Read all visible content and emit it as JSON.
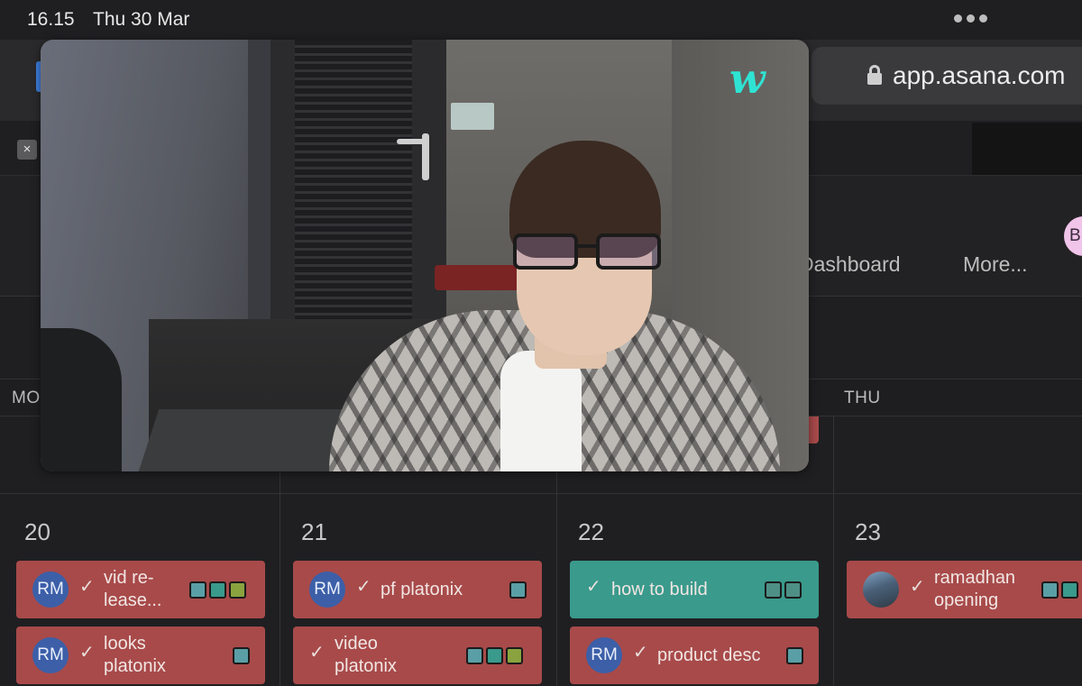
{
  "status_bar": {
    "time": "16.15",
    "date": "Thu 30 Mar"
  },
  "browser": {
    "url": "app.asana.com"
  },
  "close_tab": {
    "label": "×"
  },
  "header": {
    "nav_items": [
      "Dashboard",
      "More..."
    ],
    "avatar_initial": "B"
  },
  "calendar": {
    "day_names": [
      "MO",
      "THU"
    ],
    "days": [
      {
        "number": "20",
        "tasks": [
          {
            "title": "vid re-\nlease...",
            "assignee": "RM",
            "color": "red",
            "tags": [
              "#5a9fa6",
              "#3a9a8c",
              "#8aa33f"
            ]
          },
          {
            "title": "looks\nplatonix",
            "assignee": "RM",
            "color": "red",
            "tags": [
              "#5a9fa6"
            ]
          }
        ]
      },
      {
        "number": "21",
        "tasks": [
          {
            "title": "pf platonix",
            "assignee": "RM",
            "color": "red",
            "tags": [
              "#5a9fa6"
            ]
          },
          {
            "title": "video\nplatonix",
            "assignee": "",
            "color": "red",
            "tags": [
              "#5a9fa6",
              "#3a9a8c",
              "#8aa33f"
            ]
          }
        ]
      },
      {
        "number": "22",
        "tasks": [
          {
            "title": "how to build",
            "assignee": "",
            "color": "teal",
            "tags": [
              "#4e8f86",
              "#4e8f86"
            ]
          },
          {
            "title": "product desc",
            "assignee": "RM",
            "color": "red",
            "tags": [
              "#5a9fa6"
            ]
          }
        ]
      },
      {
        "number": "23",
        "tasks": [
          {
            "title": "ramadhan\nopening",
            "assignee": "photo",
            "color": "red",
            "tags": [
              "#5a9fa6",
              "#3a9a8c"
            ]
          }
        ]
      }
    ]
  },
  "video_overlay": {
    "logo": "w"
  },
  "colors": {
    "task_red": "#a84a4a",
    "task_teal": "#3a9a8c",
    "avatar_blue": "#3c5fa8",
    "logo_teal": "#2fe3d3"
  }
}
